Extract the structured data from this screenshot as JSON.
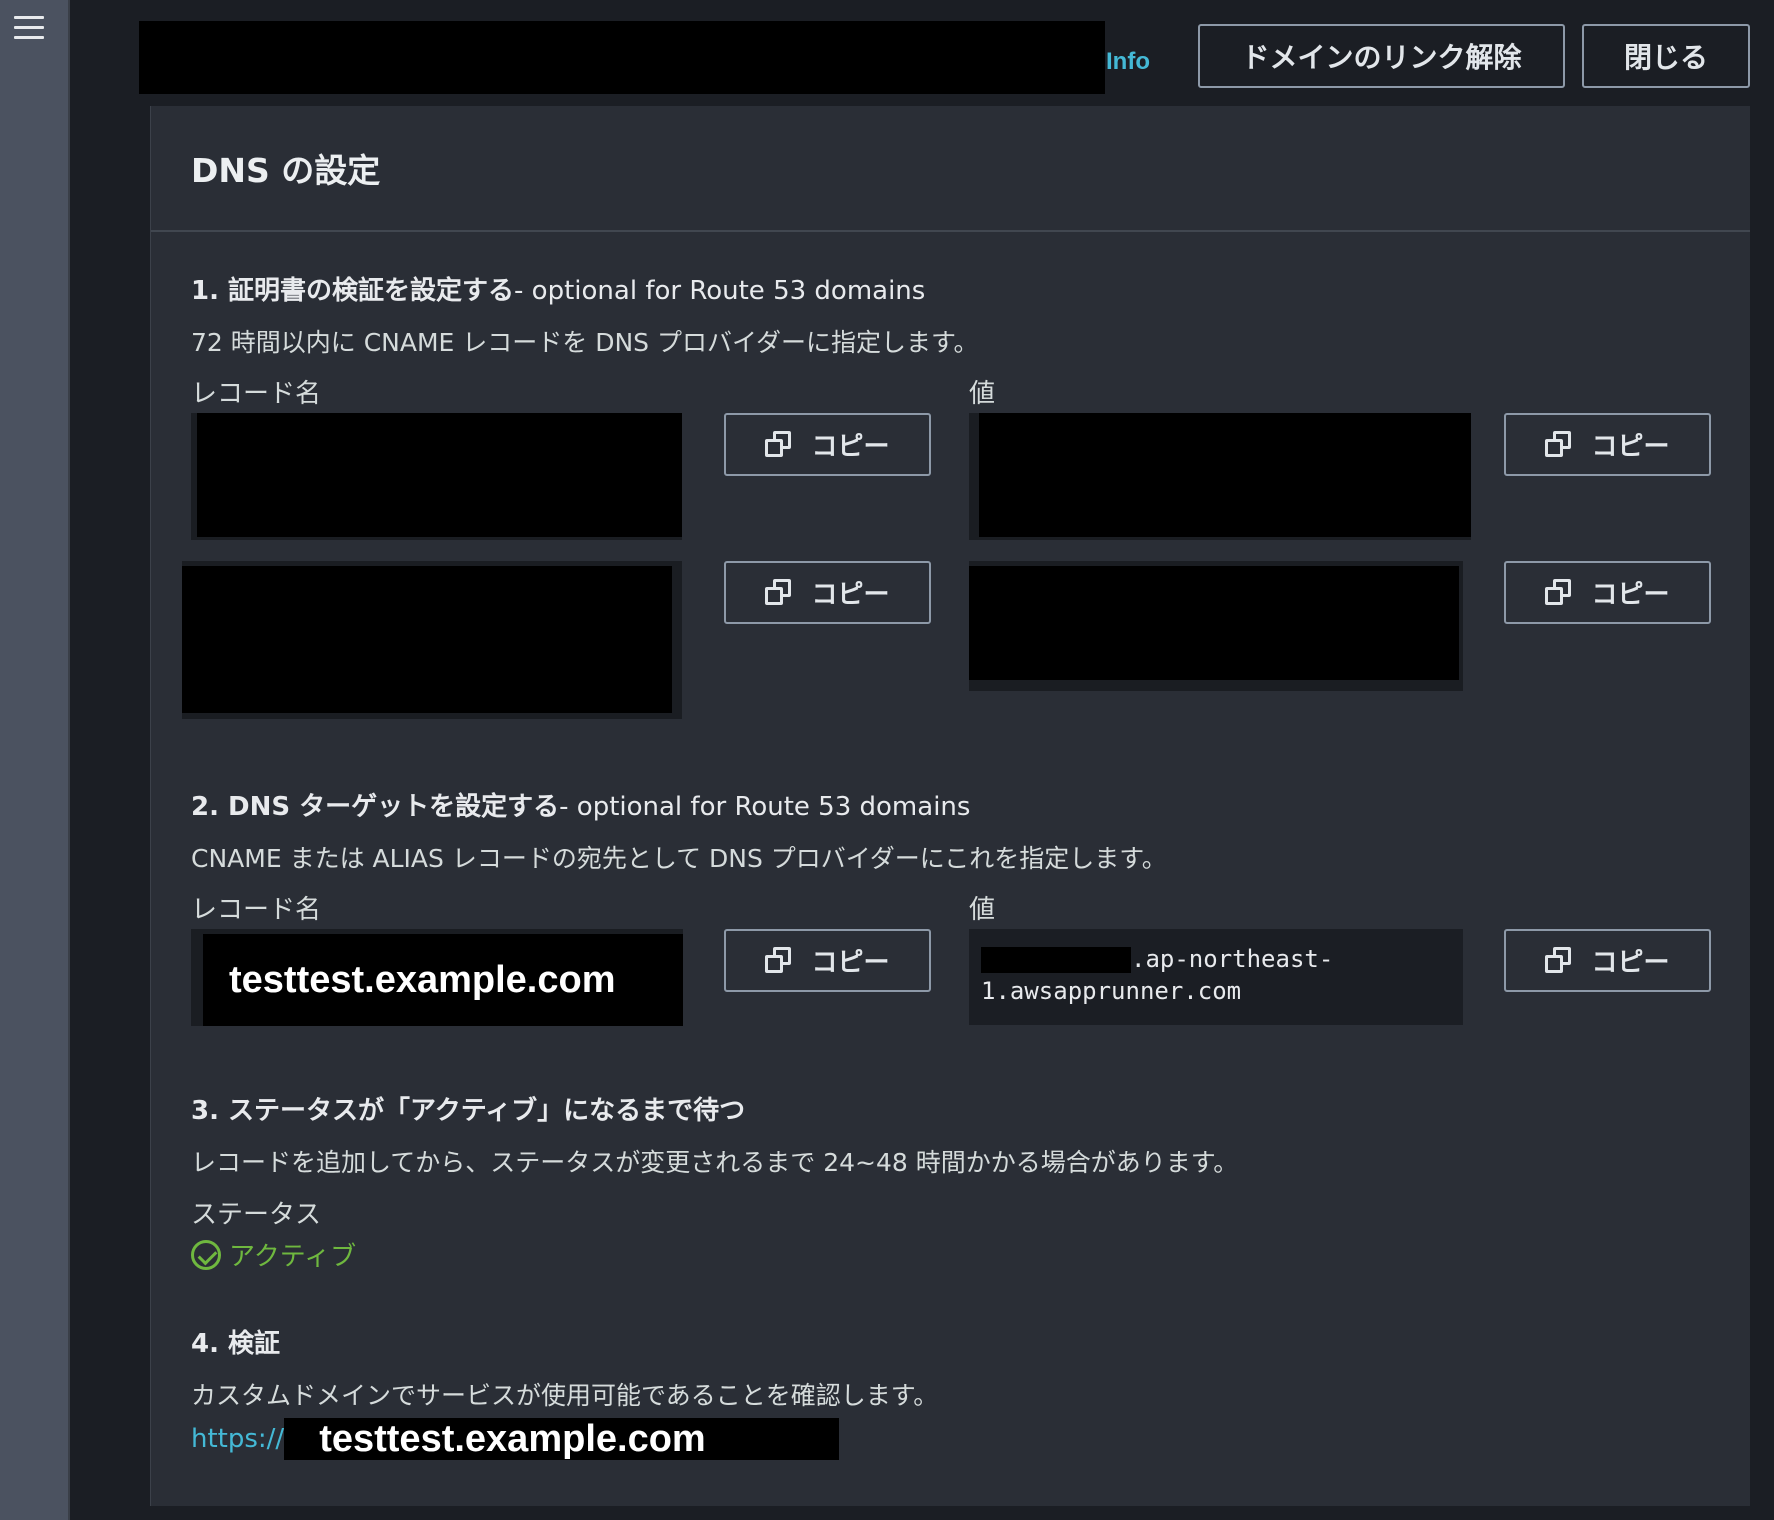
{
  "header": {
    "info_link": "Info",
    "unlink_button": "ドメインのリンク解除",
    "close_button": "閉じる"
  },
  "panel": {
    "title": "DNS の設定"
  },
  "step1": {
    "title_bold": "1. 証明書の検証を設定する",
    "title_rest": "- optional for Route 53 domains",
    "description": "72 時間以内に CNAME レコードを DNS プロバイダーに指定します。",
    "record_name_label": "レコード名",
    "value_label": "値",
    "copy_label": "コピー"
  },
  "step2": {
    "title_bold": "2. DNS ターゲットを設定する",
    "title_rest": "- optional for Route 53 domains",
    "description": "CNAME または ALIAS レコードの宛先として DNS プロバイダーにこれを指定します。",
    "record_name_label": "レコード名",
    "value_label": "値",
    "record_name_value": "testtest.example.com",
    "value_line1_suffix": ".ap-northeast-",
    "value_line2": "1.awsapprunner.com",
    "copy_label": "コピー"
  },
  "step3": {
    "title": "3. ステータスが「アクティブ」になるまで待つ",
    "description": "レコードを追加してから、ステータスが変更されるまで 24~48 時間かかる場合があります。",
    "status_label": "ステータス",
    "status_value": "アクティブ",
    "status_color": "#6fb83f"
  },
  "step4": {
    "title": "4. 検証",
    "description": "カスタムドメインでサービスが使用可能であることを確認します。",
    "url_prefix": "https://",
    "url_domain": "testtest.example.com"
  },
  "colors": {
    "link": "#44b9d6",
    "panel_bg": "#2a2e36",
    "page_bg": "#1b1e24"
  }
}
